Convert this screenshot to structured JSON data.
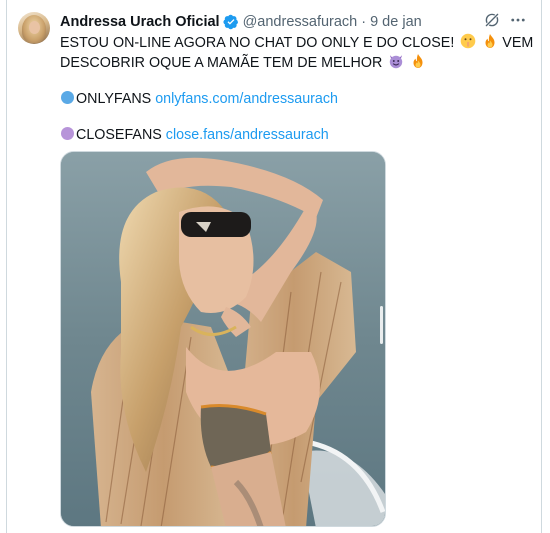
{
  "tweet": {
    "author_name": "Andressa Urach Oficial",
    "handle": "@andressafurach",
    "separator": "·",
    "date": "9 de jan",
    "line1": "ESTOU ON-LINE AGORA NO CHAT DO ONLY E DO CLOSE!",
    "line2": "VEM",
    "line3": "DESCOBRIR OQUE A MAMÃE TEM DE MELHOR",
    "onlyfans_label": "ONLYFANS",
    "onlyfans_link": "onlyfans.com/andressaurach",
    "closefans_label": "CLOSEFANS",
    "closefans_link": "close.fans/andressaurach"
  },
  "icons": {
    "verified": "verified-badge-icon",
    "grok": "grok-icon",
    "more": "more-icon"
  },
  "colors": {
    "link": "#1d9bf0",
    "verified": "#1d9bf0",
    "muted": "#536471",
    "onlyfans_circle": "#5aa9e6",
    "closefans_circle": "#b794d9"
  }
}
